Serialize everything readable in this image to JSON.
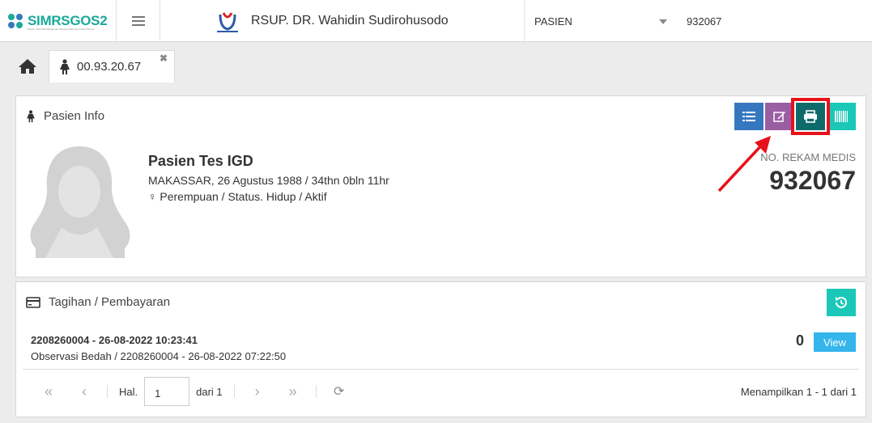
{
  "header": {
    "app_name": "SIMRSGOS2",
    "app_sub": "Sistem Informasi Manajemen Rumah Sakit Versi Open Source",
    "hospital_name": "RSUP. DR. Wahidin Sudirohusodo",
    "search_type": "PASIEN",
    "search_value": "932067"
  },
  "tabs": [
    {
      "label": "00.93.20.67"
    }
  ],
  "patient_panel": {
    "title": "Pasien Info",
    "name": "Pasien Tes IGD",
    "birth": "MAKASSAR, 26 Agustus 1988 / 34thn 0bln 11hr",
    "status": "♀ Perempuan / Status. Hidup / Aktif",
    "rm_label": "NO. REKAM MEDIS",
    "rm_value": "932067"
  },
  "billing_panel": {
    "title": "Tagihan / Pembayaran",
    "bill_no": "2208260004 - 26-08-2022 10:23:41",
    "bill_desc": "Observasi Bedah / 2208260004 - 26-08-2022 07:22:50",
    "amount": "0",
    "view_label": "View"
  },
  "pager": {
    "page_label": "Hal.",
    "page_value": "1",
    "of_label": "dari 1",
    "summary": "Menampilkan 1 - 1 dari 1"
  },
  "colors": {
    "accent": "#1bc8b8",
    "print_highlight": "#e8101a",
    "list_btn": "#3578c0",
    "edit_btn": "#9a5ea3",
    "print_btn": "#0f6b6b",
    "view_btn": "#34b5ec"
  }
}
